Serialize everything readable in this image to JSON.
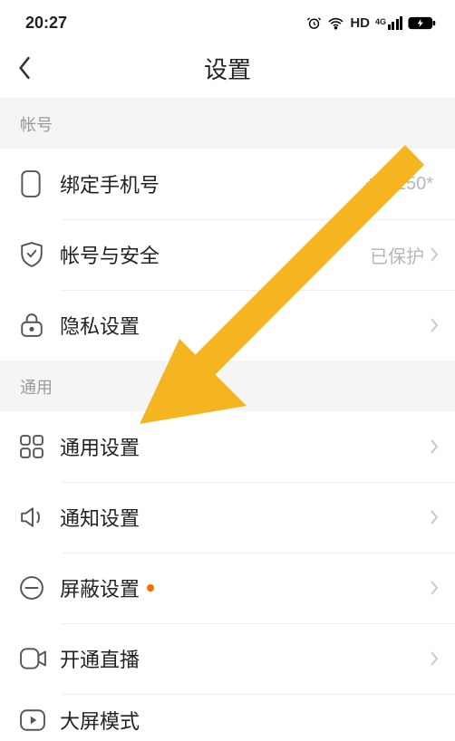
{
  "status": {
    "time": "20:27",
    "hd": "HD",
    "net_sup": "4G"
  },
  "nav": {
    "title": "设置"
  },
  "sections": {
    "account": {
      "header": "帐号"
    },
    "general": {
      "header": "通用"
    }
  },
  "rows": {
    "bind_phone": {
      "label": "绑定手机号",
      "value": "+86150*"
    },
    "security": {
      "label": "帐号与安全",
      "value": "已保护"
    },
    "privacy": {
      "label": "隐私设置"
    },
    "general_set": {
      "label": "通用设置"
    },
    "notify": {
      "label": "通知设置"
    },
    "block": {
      "label": "屏蔽设置"
    },
    "live": {
      "label": "开通直播"
    },
    "big_screen": {
      "label": "大屏模式"
    }
  },
  "annotation": {
    "color": "#f5b521"
  }
}
